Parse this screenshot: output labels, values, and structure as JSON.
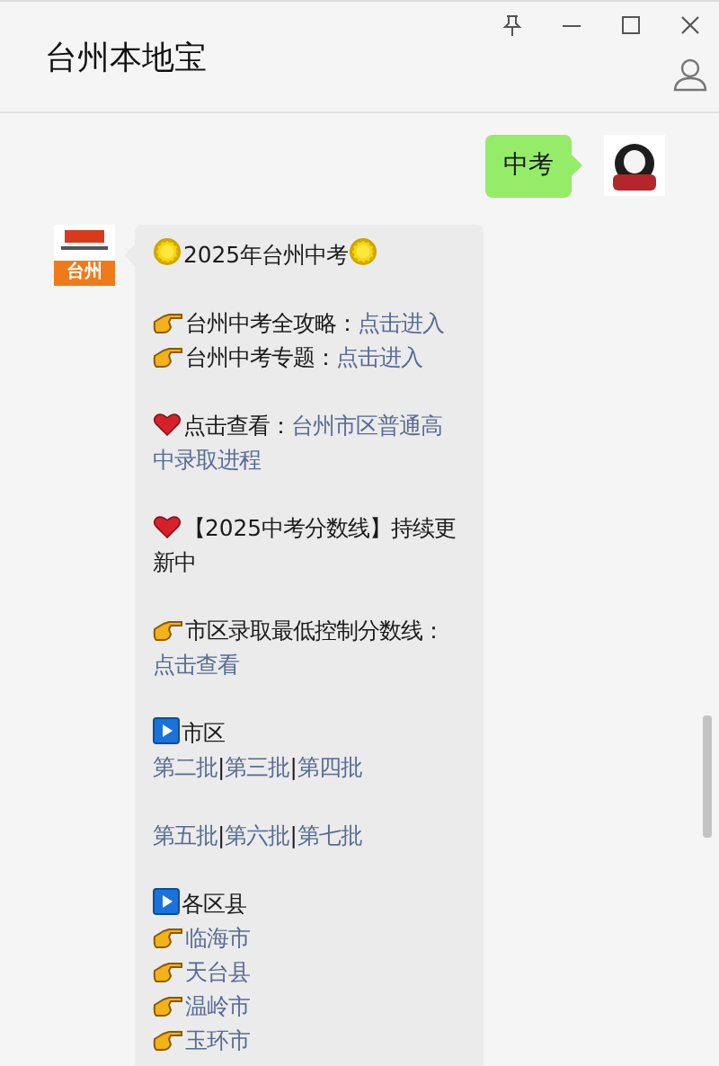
{
  "window": {
    "title": "台州本地宝"
  },
  "messages": [
    {
      "kind": "outgoing",
      "text": "中考"
    },
    {
      "kind": "incoming",
      "logo_caption": "台州",
      "paragraphs": [
        [
          {
            "kind": "sun",
            "parts": [
              {
                "kind": "text",
                "text": "2025年台州中考"
              }
            ]
          }
        ],
        [
          {
            "kind": "pointer",
            "parts": [
              {
                "kind": "text",
                "text": "台州中考全攻略："
              },
              {
                "kind": "link",
                "text": "点击进入"
              }
            ]
          },
          {
            "kind": "pointer",
            "parts": [
              {
                "kind": "text",
                "text": "台州中考专题："
              },
              {
                "kind": "link",
                "text": "点击进入"
              }
            ]
          }
        ],
        [
          {
            "kind": "heart",
            "parts": [
              {
                "kind": "text",
                "text": "点击查看："
              },
              {
                "kind": "link",
                "text": "台州市区普通高"
              }
            ]
          },
          {
            "kind": "plain",
            "parts": [
              {
                "kind": "link",
                "text": "中录取进程"
              }
            ]
          }
        ],
        [
          {
            "kind": "heart",
            "parts": [
              {
                "kind": "text",
                "text": "【2025中考分数线】持续更新中"
              }
            ]
          }
        ],
        [
          {
            "kind": "pointer",
            "parts": [
              {
                "kind": "text",
                "text": "市区录取最低控制分数线："
              },
              {
                "kind": "link",
                "text": "点击查看"
              }
            ]
          }
        ],
        [
          {
            "kind": "play",
            "parts": [
              {
                "kind": "text",
                "text": "市区"
              }
            ]
          },
          {
            "kind": "plain",
            "parts": [
              {
                "kind": "link",
                "text": "第二批"
              },
              {
                "kind": "text",
                "text": "|"
              },
              {
                "kind": "link",
                "text": "第三批"
              },
              {
                "kind": "text",
                "text": "|"
              },
              {
                "kind": "link",
                "text": "第四批"
              }
            ]
          }
        ],
        [
          {
            "kind": "plain",
            "parts": [
              {
                "kind": "link",
                "text": "第五批"
              },
              {
                "kind": "text",
                "text": "|"
              },
              {
                "kind": "link",
                "text": "第六批"
              },
              {
                "kind": "text",
                "text": "|"
              },
              {
                "kind": "link",
                "text": "第七批"
              }
            ]
          }
        ],
        [
          {
            "kind": "play",
            "parts": [
              {
                "kind": "text",
                "text": "各区县"
              }
            ]
          },
          {
            "kind": "pointer",
            "parts": [
              {
                "kind": "link",
                "text": "临海市"
              }
            ]
          },
          {
            "kind": "pointer",
            "parts": [
              {
                "kind": "link",
                "text": "天台县"
              }
            ]
          },
          {
            "kind": "pointer",
            "parts": [
              {
                "kind": "link",
                "text": "温岭市"
              }
            ]
          },
          {
            "kind": "pointer",
            "parts": [
              {
                "kind": "link",
                "text": "玉环市"
              }
            ]
          }
        ]
      ]
    }
  ]
}
